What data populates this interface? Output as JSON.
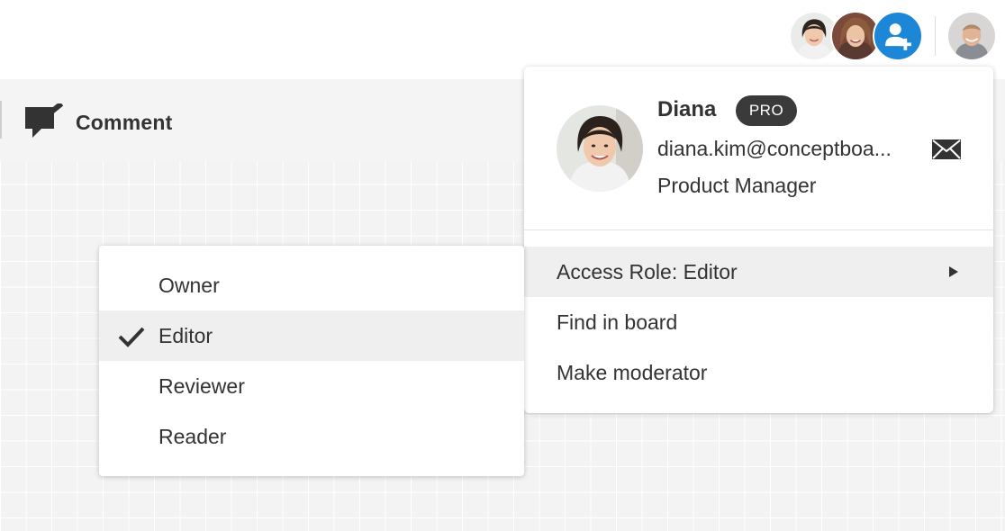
{
  "toolbar": {
    "comment_label": "Comment",
    "comment_icon": "comment-check-icon"
  },
  "header": {
    "participants": [
      {
        "name": "participant-avatar-1",
        "icon": "avatar"
      },
      {
        "name": "participant-avatar-2",
        "icon": "avatar"
      }
    ],
    "invite_icon": "add-user-icon",
    "accent_color": "#1b87d6"
  },
  "user_card": {
    "name": "Diana",
    "badge": "PRO",
    "email": "diana.kim@conceptboa...",
    "role_title": "Product Manager",
    "mail_icon": "mail-icon",
    "menu": [
      {
        "label": "Access Role: Editor",
        "has_submenu": true
      },
      {
        "label": "Find in board"
      },
      {
        "label": "Make moderator"
      }
    ]
  },
  "role_menu": {
    "items": [
      {
        "label": "Owner",
        "checked": false
      },
      {
        "label": "Editor",
        "checked": true
      },
      {
        "label": "Reviewer",
        "checked": false
      },
      {
        "label": "Reader",
        "checked": false
      }
    ]
  }
}
